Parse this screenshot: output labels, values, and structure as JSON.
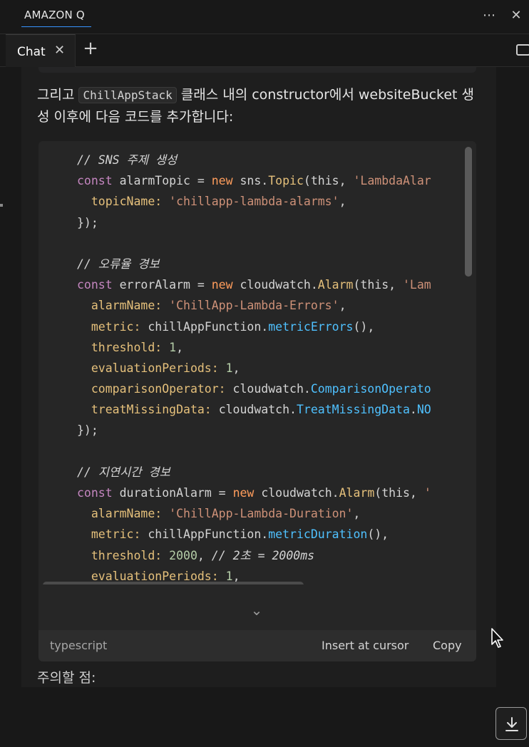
{
  "panel": {
    "title": "AMAZON Q",
    "more_icon": "more-icon",
    "close_icon": "close-icon"
  },
  "tabs": {
    "chat_label": "Chat",
    "close_icon": "close-icon",
    "add_icon": "plus-icon",
    "edge_icon": "chat-bubble-icon"
  },
  "message": {
    "intro_before": "그리고 ",
    "intro_code": "ChillAppStack",
    "intro_after": " 클래스 내의 constructor에서 websiteBucket 생성 이후에 다음 코드를 추가합니다:",
    "notes_heading": "주의할 점:"
  },
  "code_block": {
    "language": "typescript",
    "insert_label": "Insert at cursor",
    "copy_label": "Copy",
    "lines": [
      [
        {
          "t": "// SNS 주제 생성",
          "c": "cmt"
        }
      ],
      [
        {
          "t": "const ",
          "c": "kw"
        },
        {
          "t": "alarmTopic = ",
          "c": ""
        },
        {
          "t": "new ",
          "c": "new"
        },
        {
          "t": "sns.",
          "c": ""
        },
        {
          "t": "Topic",
          "c": "cls"
        },
        {
          "t": "(this, ",
          "c": ""
        },
        {
          "t": "'LambdaAlar",
          "c": "str"
        }
      ],
      [
        {
          "t": "  topicName: ",
          "c": "prop"
        },
        {
          "t": "'chillapp-lambda-alarms'",
          "c": "str"
        },
        {
          "t": ",",
          "c": ""
        }
      ],
      [
        {
          "t": "});",
          "c": ""
        }
      ],
      [
        {
          "t": "",
          "c": ""
        }
      ],
      [
        {
          "t": "// 오류율 경보",
          "c": "cmt"
        }
      ],
      [
        {
          "t": "const ",
          "c": "kw"
        },
        {
          "t": "errorAlarm = ",
          "c": ""
        },
        {
          "t": "new ",
          "c": "new"
        },
        {
          "t": "cloudwatch.",
          "c": ""
        },
        {
          "t": "Alarm",
          "c": "cls"
        },
        {
          "t": "(this, ",
          "c": ""
        },
        {
          "t": "'Lam",
          "c": "str"
        }
      ],
      [
        {
          "t": "  alarmName: ",
          "c": "prop"
        },
        {
          "t": "'ChillApp-Lambda-Errors'",
          "c": "str"
        },
        {
          "t": ",",
          "c": ""
        }
      ],
      [
        {
          "t": "  metric: ",
          "c": "prop"
        },
        {
          "t": "chillAppFunction.",
          "c": ""
        },
        {
          "t": "metricErrors",
          "c": "fn"
        },
        {
          "t": "(),",
          "c": ""
        }
      ],
      [
        {
          "t": "  threshold: ",
          "c": "prop"
        },
        {
          "t": "1",
          "c": "num"
        },
        {
          "t": ",",
          "c": ""
        }
      ],
      [
        {
          "t": "  evaluationPeriods: ",
          "c": "prop"
        },
        {
          "t": "1",
          "c": "num"
        },
        {
          "t": ",",
          "c": ""
        }
      ],
      [
        {
          "t": "  comparisonOperator: ",
          "c": "prop"
        },
        {
          "t": "cloudwatch.",
          "c": ""
        },
        {
          "t": "ComparisonOperato",
          "c": "fn"
        }
      ],
      [
        {
          "t": "  treatMissingData: ",
          "c": "prop"
        },
        {
          "t": "cloudwatch.",
          "c": ""
        },
        {
          "t": "TreatMissingData",
          "c": "fn"
        },
        {
          "t": ".",
          "c": ""
        },
        {
          "t": "NO",
          "c": "fn"
        }
      ],
      [
        {
          "t": "});",
          "c": ""
        }
      ],
      [
        {
          "t": "",
          "c": ""
        }
      ],
      [
        {
          "t": "// 지연시간 경보",
          "c": "cmt"
        }
      ],
      [
        {
          "t": "const ",
          "c": "kw"
        },
        {
          "t": "durationAlarm = ",
          "c": ""
        },
        {
          "t": "new ",
          "c": "new"
        },
        {
          "t": "cloudwatch.",
          "c": ""
        },
        {
          "t": "Alarm",
          "c": "cls"
        },
        {
          "t": "(this, ",
          "c": ""
        },
        {
          "t": "'",
          "c": "str"
        }
      ],
      [
        {
          "t": "  alarmName: ",
          "c": "prop"
        },
        {
          "t": "'ChillApp-Lambda-Duration'",
          "c": "str"
        },
        {
          "t": ",",
          "c": ""
        }
      ],
      [
        {
          "t": "  metric: ",
          "c": "prop"
        },
        {
          "t": "chillAppFunction.",
          "c": ""
        },
        {
          "t": "metricDuration",
          "c": "fn"
        },
        {
          "t": "(),",
          "c": ""
        }
      ],
      [
        {
          "t": "  threshold: ",
          "c": "prop"
        },
        {
          "t": "2000",
          "c": "num"
        },
        {
          "t": ", ",
          "c": ""
        },
        {
          "t": "// 2초 = 2000ms",
          "c": "cmt"
        }
      ],
      [
        {
          "t": "  evaluationPeriods: ",
          "c": "prop"
        },
        {
          "t": "1",
          "c": "num"
        },
        {
          "t": ",",
          "c": ""
        }
      ]
    ]
  },
  "scroll_to_bottom_icon": "arrow-down-to-line-icon",
  "colors": {
    "accent": "#3794ff",
    "background": "#181818",
    "code_background": "#262626"
  }
}
